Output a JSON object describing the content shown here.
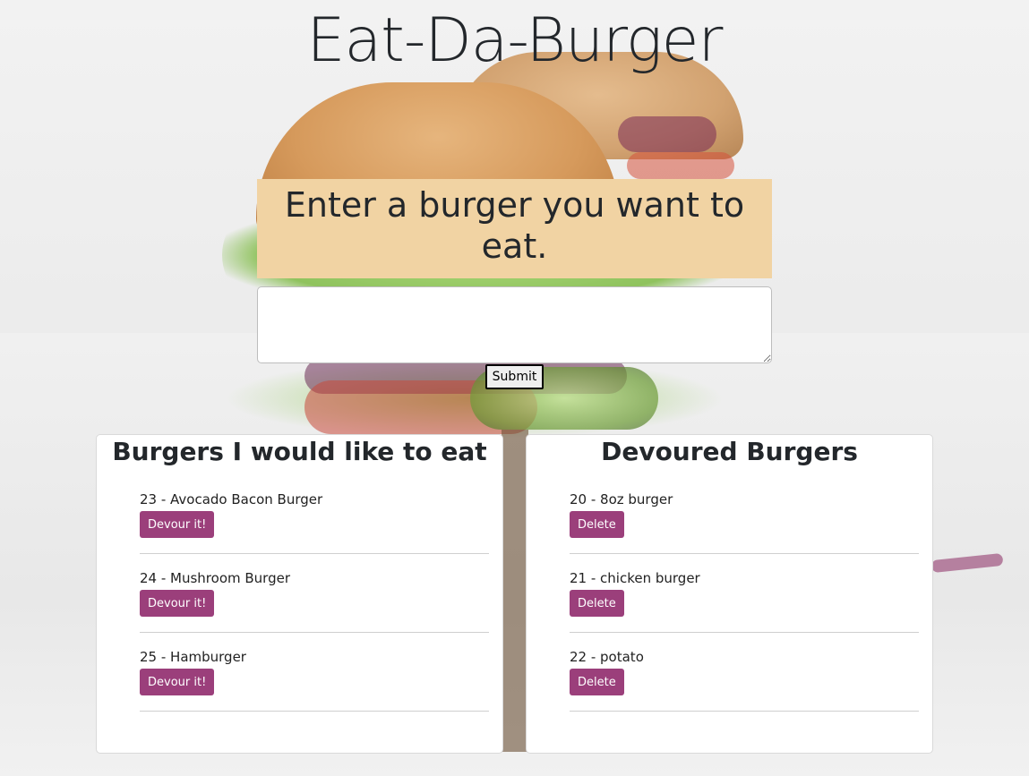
{
  "app": {
    "title": "Eat-Da-Burger"
  },
  "form": {
    "prompt": "Enter a burger you want to eat.",
    "input_value": "",
    "submit_label": "Submit"
  },
  "uneaten": {
    "heading": "Burgers I would like to eat",
    "items": [
      {
        "text": "23 - Avocado Bacon Burger",
        "button_label": "Devour it!"
      },
      {
        "text": "24 - Mushroom Burger",
        "button_label": "Devour it!"
      },
      {
        "text": "25 - Hamburger",
        "button_label": "Devour it!"
      }
    ]
  },
  "devoured": {
    "heading": "Devoured Burgers",
    "items": [
      {
        "text": "20 - 8oz burger",
        "button_label": "Delete"
      },
      {
        "text": "21 - chicken burger",
        "button_label": "Delete"
      },
      {
        "text": "22 - potato",
        "button_label": "Delete"
      }
    ]
  },
  "colors": {
    "prompt_bg": "#f1d3a3",
    "button_bg": "#9b3f7b",
    "button_text": "#ffffff"
  }
}
